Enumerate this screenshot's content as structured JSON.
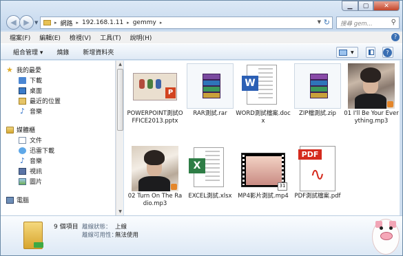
{
  "window": {
    "minimize_glyph": "▁",
    "maximize_glyph": "▢",
    "close_glyph": "✕"
  },
  "address": {
    "segments": [
      "網路",
      "192.168.1.11",
      "gemmy"
    ],
    "search_placeholder": "搜尋 gem..."
  },
  "menu": [
    "檔案(F)",
    "編輯(E)",
    "檢視(V)",
    "工具(T)",
    "說明(H)"
  ],
  "toolbar": {
    "organize": "組合管理 ▾",
    "burn": "燒錄",
    "new_folder": "新增資料夾"
  },
  "nav": {
    "favorites_label": "我的最愛",
    "favorites": [
      {
        "label": "下載",
        "icon": "download-folder-icon"
      },
      {
        "label": "桌面",
        "icon": "desktop-icon"
      },
      {
        "label": "最近的位置",
        "icon": "recent-places-icon"
      },
      {
        "label": "音樂",
        "icon": "music-note-icon"
      }
    ],
    "libraries_label": "媒體櫃",
    "libraries": [
      {
        "label": "文件",
        "icon": "documents-icon"
      },
      {
        "label": "迅雷下載",
        "icon": "thunder-icon"
      },
      {
        "label": "音樂",
        "icon": "music-note-icon"
      },
      {
        "label": "視訊",
        "icon": "videos-icon"
      },
      {
        "label": "圖片",
        "icon": "pictures-icon"
      }
    ],
    "computer_label": "電腦"
  },
  "files": [
    {
      "name": "POWERPOINT測試OFFICE2013.pptx",
      "type": "pptx",
      "icon": "powerpoint-file-icon"
    },
    {
      "name": "RAR測試.rar",
      "type": "rar",
      "icon": "winrar-archive-icon"
    },
    {
      "name": "WORD測試檔案.docx",
      "type": "docx",
      "icon": "word-file-icon",
      "badge": "W"
    },
    {
      "name": "ZIP檔測試.zip",
      "type": "zip",
      "icon": "zip-archive-icon"
    },
    {
      "name": "01 I'll Be Your Everything.mp3",
      "type": "mp3",
      "icon": "album-art-icon"
    },
    {
      "name": "02 Turn On The Radio.mp3",
      "type": "mp3",
      "icon": "album-art-icon"
    },
    {
      "name": "EXCEL測試.xlsx",
      "type": "xlsx",
      "icon": "excel-file-icon",
      "badge": "X"
    },
    {
      "name": "MP4影片測試.mp4",
      "type": "mp4",
      "icon": "video-thumbnail-icon",
      "cal": "31"
    },
    {
      "name": "PDF測試檔案.pdf",
      "type": "pdf",
      "icon": "pdf-file-icon",
      "tag": "PDF"
    }
  ],
  "details": {
    "count": "9 個項目",
    "k1": "離線狀態：",
    "v1": "上線",
    "k2": "離線可用性：",
    "v2": "無法使用"
  }
}
